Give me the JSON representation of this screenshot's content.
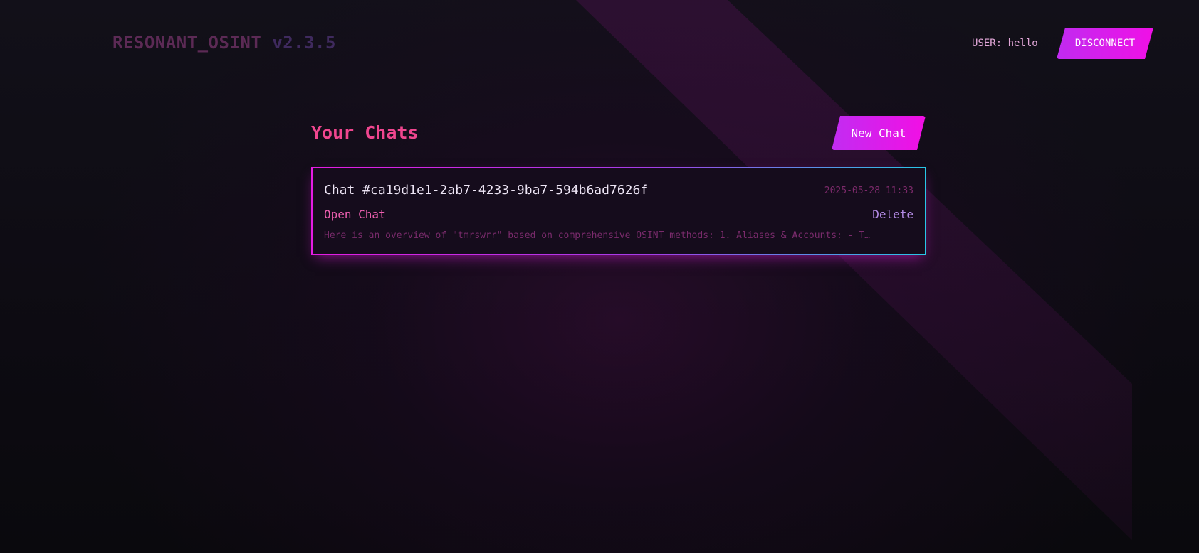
{
  "header": {
    "brand_name": "RESONANT_OSINT",
    "brand_version": "v2.3.5",
    "user_label": "USER: hello",
    "disconnect_label": "DISCONNECT"
  },
  "main": {
    "heading": "Your Chats",
    "new_chat_label": "New Chat",
    "chats": [
      {
        "title": "Chat #ca19d1e1-2ab7-4233-9ba7-594b6ad7626f",
        "date": "2025-05-28 11:33",
        "open_label": "Open Chat",
        "delete_label": "Delete",
        "preview": "Here is an overview of \"tmrswrr\" based on comprehensive OSINT methods: 1. Aliases & Accounts: - T…"
      }
    ]
  },
  "colors": {
    "accent_magenta": "#f010e6",
    "accent_violet": "#c02bf0",
    "heading_pink": "#f0468f",
    "card_border_cyan": "#27c8e6"
  }
}
